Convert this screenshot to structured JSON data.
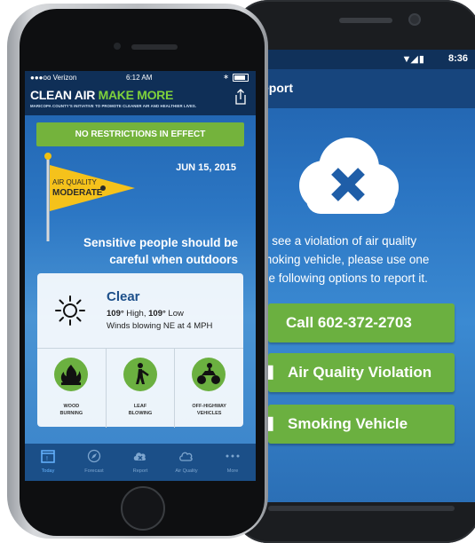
{
  "android": {
    "status_time": "8:36",
    "appbar_title": "eport",
    "message_lines": [
      "u see a violation of air quality",
      "moking vehicle, please use one",
      "ne following options to report it."
    ],
    "buttons": [
      {
        "label": "Call 602-372-2703"
      },
      {
        "label": "Air Quality Violation"
      },
      {
        "label": "Smoking Vehicle"
      }
    ]
  },
  "iphone": {
    "status": {
      "carrier": "●●●oo Verizon",
      "time": "6:12 AM"
    },
    "brand": {
      "part1": "CLEAN AIR",
      "part2": "MAKE MORE"
    },
    "tagline": "MARICOPA COUNTY'S INITIATIVE TO PROMOTE CLEANER AIR AND HEALTHIER LIVES.",
    "restriction": "NO RESTRICTIONS IN EFFECT",
    "flag": {
      "line1": "AIR QUALITY",
      "line2": "MODERATE"
    },
    "date": "JUN 15, 2015",
    "sensitive_lines": [
      "Sensitive people should be",
      "careful when outdoors"
    ],
    "weather": {
      "condition": "Clear",
      "high_value": "109°",
      "high_label": " High, ",
      "low_value": "109°",
      "low_label": " Low",
      "wind": "Winds blowing NE at 4 MPH"
    },
    "tiles": [
      {
        "line1": "WOOD",
        "line2": "BURNING"
      },
      {
        "line1": "LEAF",
        "line2": "BLOWING"
      },
      {
        "line1": "OFF-HIGHWAY",
        "line2": "VEHICLES"
      }
    ],
    "tabs": [
      {
        "label": "Today"
      },
      {
        "label": "Forecast"
      },
      {
        "label": "Report"
      },
      {
        "label": "Air Quality"
      },
      {
        "label": "More"
      }
    ]
  },
  "colors": {
    "accent_green": "#74b33c",
    "brand_green": "#7fd13b",
    "header_navy": "#0f2f57",
    "sky_blue": "#2c77c4"
  }
}
